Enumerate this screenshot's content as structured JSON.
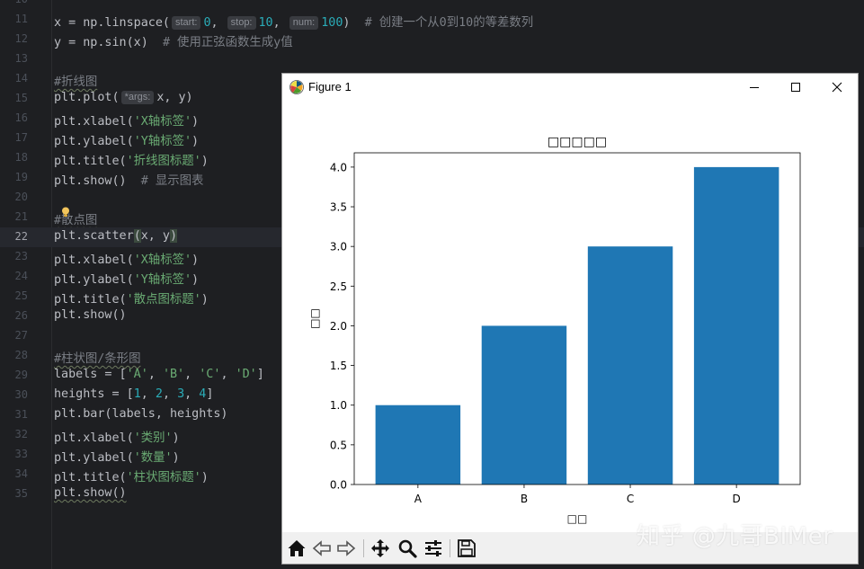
{
  "editor": {
    "lines": [
      {
        "num": "10",
        "segments": []
      },
      {
        "num": "11",
        "segments": [
          {
            "t": "x = np.linspace(",
            "c": ""
          },
          {
            "t": "start:",
            "c": "hint"
          },
          {
            "t": "0",
            "c": "num"
          },
          {
            "t": ", ",
            "c": ""
          },
          {
            "t": "stop:",
            "c": "hint"
          },
          {
            "t": "10",
            "c": "num"
          },
          {
            "t": ", ",
            "c": ""
          },
          {
            "t": "num:",
            "c": "hint"
          },
          {
            "t": "100",
            "c": "num"
          },
          {
            "t": ")  ",
            "c": ""
          },
          {
            "t": "# 创建一个从0到10的等差数列",
            "c": "cmt"
          }
        ]
      },
      {
        "num": "12",
        "segments": [
          {
            "t": "y = np.sin(x)  ",
            "c": ""
          },
          {
            "t": "# 使用正弦函数生成y值",
            "c": "cmt"
          }
        ]
      },
      {
        "num": "13",
        "segments": []
      },
      {
        "num": "14",
        "segments": [
          {
            "t": "#折线图",
            "c": "cmt squiggle"
          }
        ]
      },
      {
        "num": "15",
        "segments": [
          {
            "t": "plt.plot(",
            "c": ""
          },
          {
            "t": "*args:",
            "c": "hint"
          },
          {
            "t": "x, y)",
            "c": ""
          }
        ]
      },
      {
        "num": "16",
        "segments": [
          {
            "t": "plt.xlabel(",
            "c": ""
          },
          {
            "t": "'X轴标签'",
            "c": "str"
          },
          {
            "t": ")",
            "c": ""
          }
        ]
      },
      {
        "num": "17",
        "segments": [
          {
            "t": "plt.ylabel(",
            "c": ""
          },
          {
            "t": "'Y轴标签'",
            "c": "str"
          },
          {
            "t": ")",
            "c": ""
          }
        ]
      },
      {
        "num": "18",
        "segments": [
          {
            "t": "plt.title(",
            "c": ""
          },
          {
            "t": "'折线图标题'",
            "c": "str"
          },
          {
            "t": ")",
            "c": ""
          }
        ]
      },
      {
        "num": "19",
        "segments": [
          {
            "t": "plt.show()  ",
            "c": ""
          },
          {
            "t": "# 显示图表",
            "c": "cmt"
          }
        ]
      },
      {
        "num": "20",
        "segments": []
      },
      {
        "num": "21",
        "segments": [
          {
            "t": "#散点图",
            "c": "cmt squiggle"
          }
        ]
      },
      {
        "num": "22",
        "current": true,
        "segments": [
          {
            "t": "plt.scatter",
            "c": ""
          },
          {
            "t": "(",
            "c": "bracket-hl"
          },
          {
            "t": "x, y",
            "c": ""
          },
          {
            "t": ")",
            "c": "bracket-hl"
          }
        ]
      },
      {
        "num": "23",
        "segments": [
          {
            "t": "plt.xlabel(",
            "c": ""
          },
          {
            "t": "'X轴标签'",
            "c": "str"
          },
          {
            "t": ")",
            "c": ""
          }
        ]
      },
      {
        "num": "24",
        "segments": [
          {
            "t": "plt.ylabel(",
            "c": ""
          },
          {
            "t": "'Y轴标签'",
            "c": "str"
          },
          {
            "t": ")",
            "c": ""
          }
        ]
      },
      {
        "num": "25",
        "segments": [
          {
            "t": "plt.title(",
            "c": ""
          },
          {
            "t": "'散点图标题'",
            "c": "str"
          },
          {
            "t": ")",
            "c": ""
          }
        ]
      },
      {
        "num": "26",
        "segments": [
          {
            "t": "plt.show()",
            "c": ""
          }
        ]
      },
      {
        "num": "27",
        "segments": []
      },
      {
        "num": "28",
        "segments": [
          {
            "t": "#柱状图/条形图",
            "c": "cmt squiggle"
          }
        ]
      },
      {
        "num": "29",
        "segments": [
          {
            "t": "labels = [",
            "c": ""
          },
          {
            "t": "'A'",
            "c": "str"
          },
          {
            "t": ", ",
            "c": ""
          },
          {
            "t": "'B'",
            "c": "str"
          },
          {
            "t": ", ",
            "c": ""
          },
          {
            "t": "'C'",
            "c": "str"
          },
          {
            "t": ", ",
            "c": ""
          },
          {
            "t": "'D'",
            "c": "str"
          },
          {
            "t": "]",
            "c": ""
          }
        ]
      },
      {
        "num": "30",
        "segments": [
          {
            "t": "heights = [",
            "c": ""
          },
          {
            "t": "1",
            "c": "num"
          },
          {
            "t": ", ",
            "c": ""
          },
          {
            "t": "2",
            "c": "num"
          },
          {
            "t": ", ",
            "c": ""
          },
          {
            "t": "3",
            "c": "num"
          },
          {
            "t": ", ",
            "c": ""
          },
          {
            "t": "4",
            "c": "num"
          },
          {
            "t": "]",
            "c": ""
          }
        ]
      },
      {
        "num": "31",
        "segments": [
          {
            "t": "plt.bar(labels, heights)",
            "c": ""
          }
        ]
      },
      {
        "num": "32",
        "segments": [
          {
            "t": "plt.xlabel(",
            "c": ""
          },
          {
            "t": "'类别'",
            "c": "str"
          },
          {
            "t": ")",
            "c": ""
          }
        ]
      },
      {
        "num": "33",
        "segments": [
          {
            "t": "plt.ylabel(",
            "c": ""
          },
          {
            "t": "'数量'",
            "c": "str"
          },
          {
            "t": ")",
            "c": ""
          }
        ]
      },
      {
        "num": "34",
        "segments": [
          {
            "t": "plt.title(",
            "c": ""
          },
          {
            "t": "'柱状图标题'",
            "c": "str"
          },
          {
            "t": ")",
            "c": ""
          }
        ]
      },
      {
        "num": "35",
        "segments": [
          {
            "t": "plt.show()",
            "c": "squiggle"
          }
        ]
      }
    ]
  },
  "figure_window": {
    "title": "Figure 1",
    "icon": "matplotlib-logo-icon",
    "controls": [
      "minimize-icon",
      "maximize-icon",
      "close-icon"
    ],
    "toolbar": [
      "home-icon",
      "back-arrow-icon",
      "forward-arrow-icon",
      "pan-move-icon",
      "zoom-magnifier-icon",
      "configure-sliders-icon",
      "save-disk-icon"
    ]
  },
  "chart_data": {
    "type": "bar",
    "title": "□□□□□",
    "xlabel": "□□",
    "ylabel": "□□",
    "categories": [
      "A",
      "B",
      "C",
      "D"
    ],
    "values": [
      1,
      2,
      3,
      4
    ],
    "ylim": [
      0,
      4.18
    ],
    "yticks": [
      "0.0",
      "0.5",
      "1.0",
      "1.5",
      "2.0",
      "2.5",
      "3.0",
      "3.5",
      "4.0"
    ],
    "ytick_values": [
      0,
      0.5,
      1.0,
      1.5,
      2.0,
      2.5,
      3.0,
      3.5,
      4.0
    ],
    "grid": false,
    "bar_color": "#1f77b4"
  },
  "watermark": "知乎 @九哥BIMer",
  "colors": {
    "editor_bg": "#1e1f22",
    "string": "#6aab73",
    "number": "#2aacb8",
    "comment": "#7a7e85",
    "bar": "#1f77b4"
  }
}
